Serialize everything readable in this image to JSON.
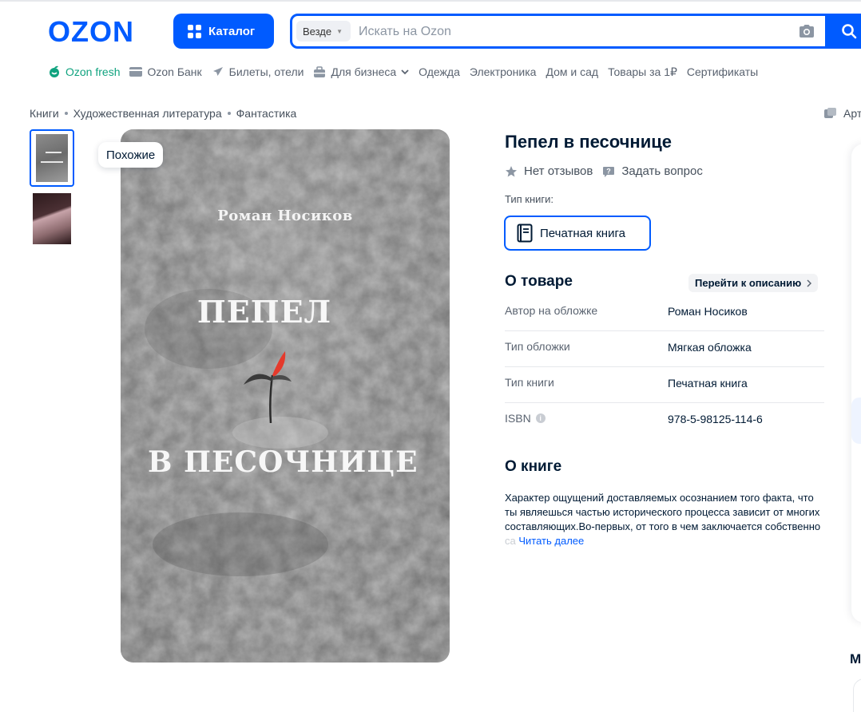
{
  "header": {
    "logo_text": "OZON",
    "catalog_label": "Каталог",
    "search": {
      "scope": "Везде",
      "placeholder": "Искать на Ozon",
      "value": ""
    }
  },
  "nav": {
    "items": [
      {
        "label": "Ozon fresh",
        "icon": "fresh-icon"
      },
      {
        "label": "Ozon Банк",
        "icon": "card-icon"
      },
      {
        "label": "Билеты, отели",
        "icon": "plane-icon"
      },
      {
        "label": "Для бизнеса",
        "icon": "business-icon"
      },
      {
        "label": "Одежда"
      },
      {
        "label": "Электроника"
      },
      {
        "label": "Дом и сад"
      },
      {
        "label": "Товары за 1₽"
      },
      {
        "label": "Сертификаты"
      }
    ]
  },
  "breadcrumb": [
    "Книги",
    "Художественная литература",
    "Фантастика"
  ],
  "article_label": "Арт",
  "gallery": {
    "similar_label": "Похожие",
    "cover": {
      "author": "Роман Носиков",
      "title_line1": "ПЕПЕЛ",
      "title_line2": "В ПЕСОЧНИЦЕ"
    }
  },
  "product": {
    "title": "Пепел в песочнице",
    "reviews_label": "Нет отзывов",
    "ask_label": "Задать вопрос",
    "type_label": "Тип книги:",
    "type_value": "Печатная книга"
  },
  "about": {
    "heading": "О товаре",
    "goto_label": "Перейти к описанию",
    "specs": [
      {
        "key": "Автор на обложке",
        "value": "Роман Носиков"
      },
      {
        "key": "Тип обложки",
        "value": "Мягкая обложка"
      },
      {
        "key": "Тип книги",
        "value": "Печатная книга"
      },
      {
        "key": "ISBN",
        "value": "978-5-98125-114-6"
      }
    ]
  },
  "book": {
    "heading": "О книге",
    "description": "Характер ощущений доставляемых осознанием того факта, что ты являешься частью исторического процесса зависит от многих составляющих.Во-первых, от того в чем заключается собственно",
    "description_fade": " са",
    "read_more": "Читать далее"
  },
  "edge": {
    "letter": "М"
  },
  "colors": {
    "brand": "#005bff",
    "fresh": "#10a37f",
    "text": "#001a34"
  }
}
